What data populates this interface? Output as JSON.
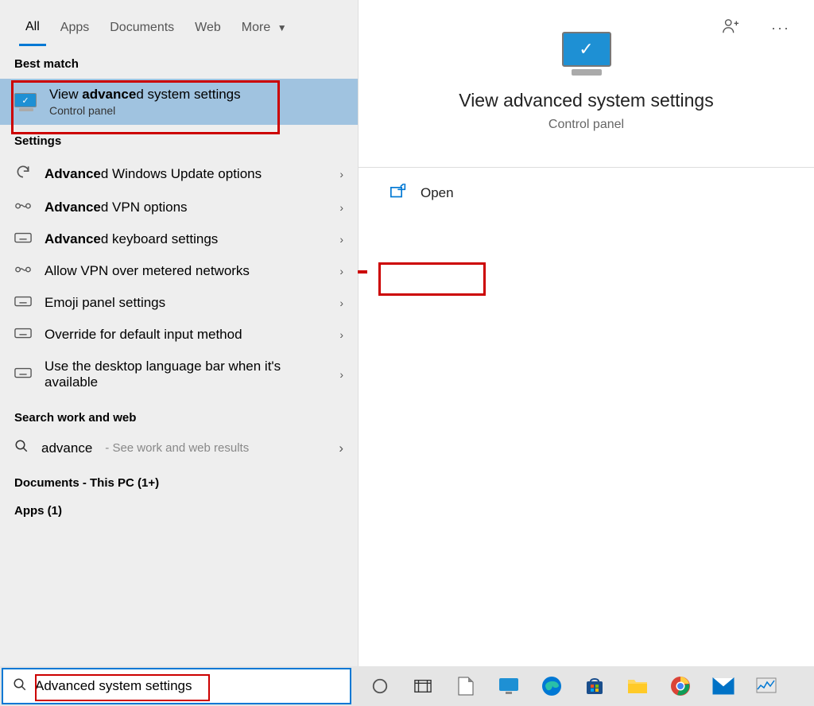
{
  "tabs": {
    "all": "All",
    "apps": "Apps",
    "documents": "Documents",
    "web": "Web",
    "more": "More"
  },
  "sections": {
    "best_match": "Best match",
    "settings": "Settings",
    "search_work_web": "Search work and web",
    "documents": "Documents - This PC (1+)",
    "apps": "Apps (1)"
  },
  "best_match_item": {
    "title_pre": "View ",
    "title_bold": "advance",
    "title_post": "d system settings",
    "subtitle": "Control panel"
  },
  "settings_items": [
    {
      "bold": "Advance",
      "rest": "d Windows Update options",
      "icon": "refresh"
    },
    {
      "bold": "Advance",
      "rest": "d VPN options",
      "icon": "vpn"
    },
    {
      "bold": "Advance",
      "rest": "d keyboard settings",
      "icon": "keyboard"
    },
    {
      "bold": "",
      "rest": "Allow VPN over metered networks",
      "icon": "vpn"
    },
    {
      "bold": "",
      "rest": "Emoji panel settings",
      "icon": "keyboard"
    },
    {
      "bold": "",
      "rest": "Override for default input method",
      "icon": "keyboard"
    },
    {
      "bold": "",
      "rest": "Use the desktop language bar when it's available",
      "icon": "keyboard"
    }
  ],
  "web_item": {
    "query": "advance",
    "sub": " - See work and web results"
  },
  "right_panel": {
    "title": "View advanced system settings",
    "subtitle": "Control panel",
    "open": "Open"
  },
  "search": {
    "value": "Advanced system settings"
  }
}
